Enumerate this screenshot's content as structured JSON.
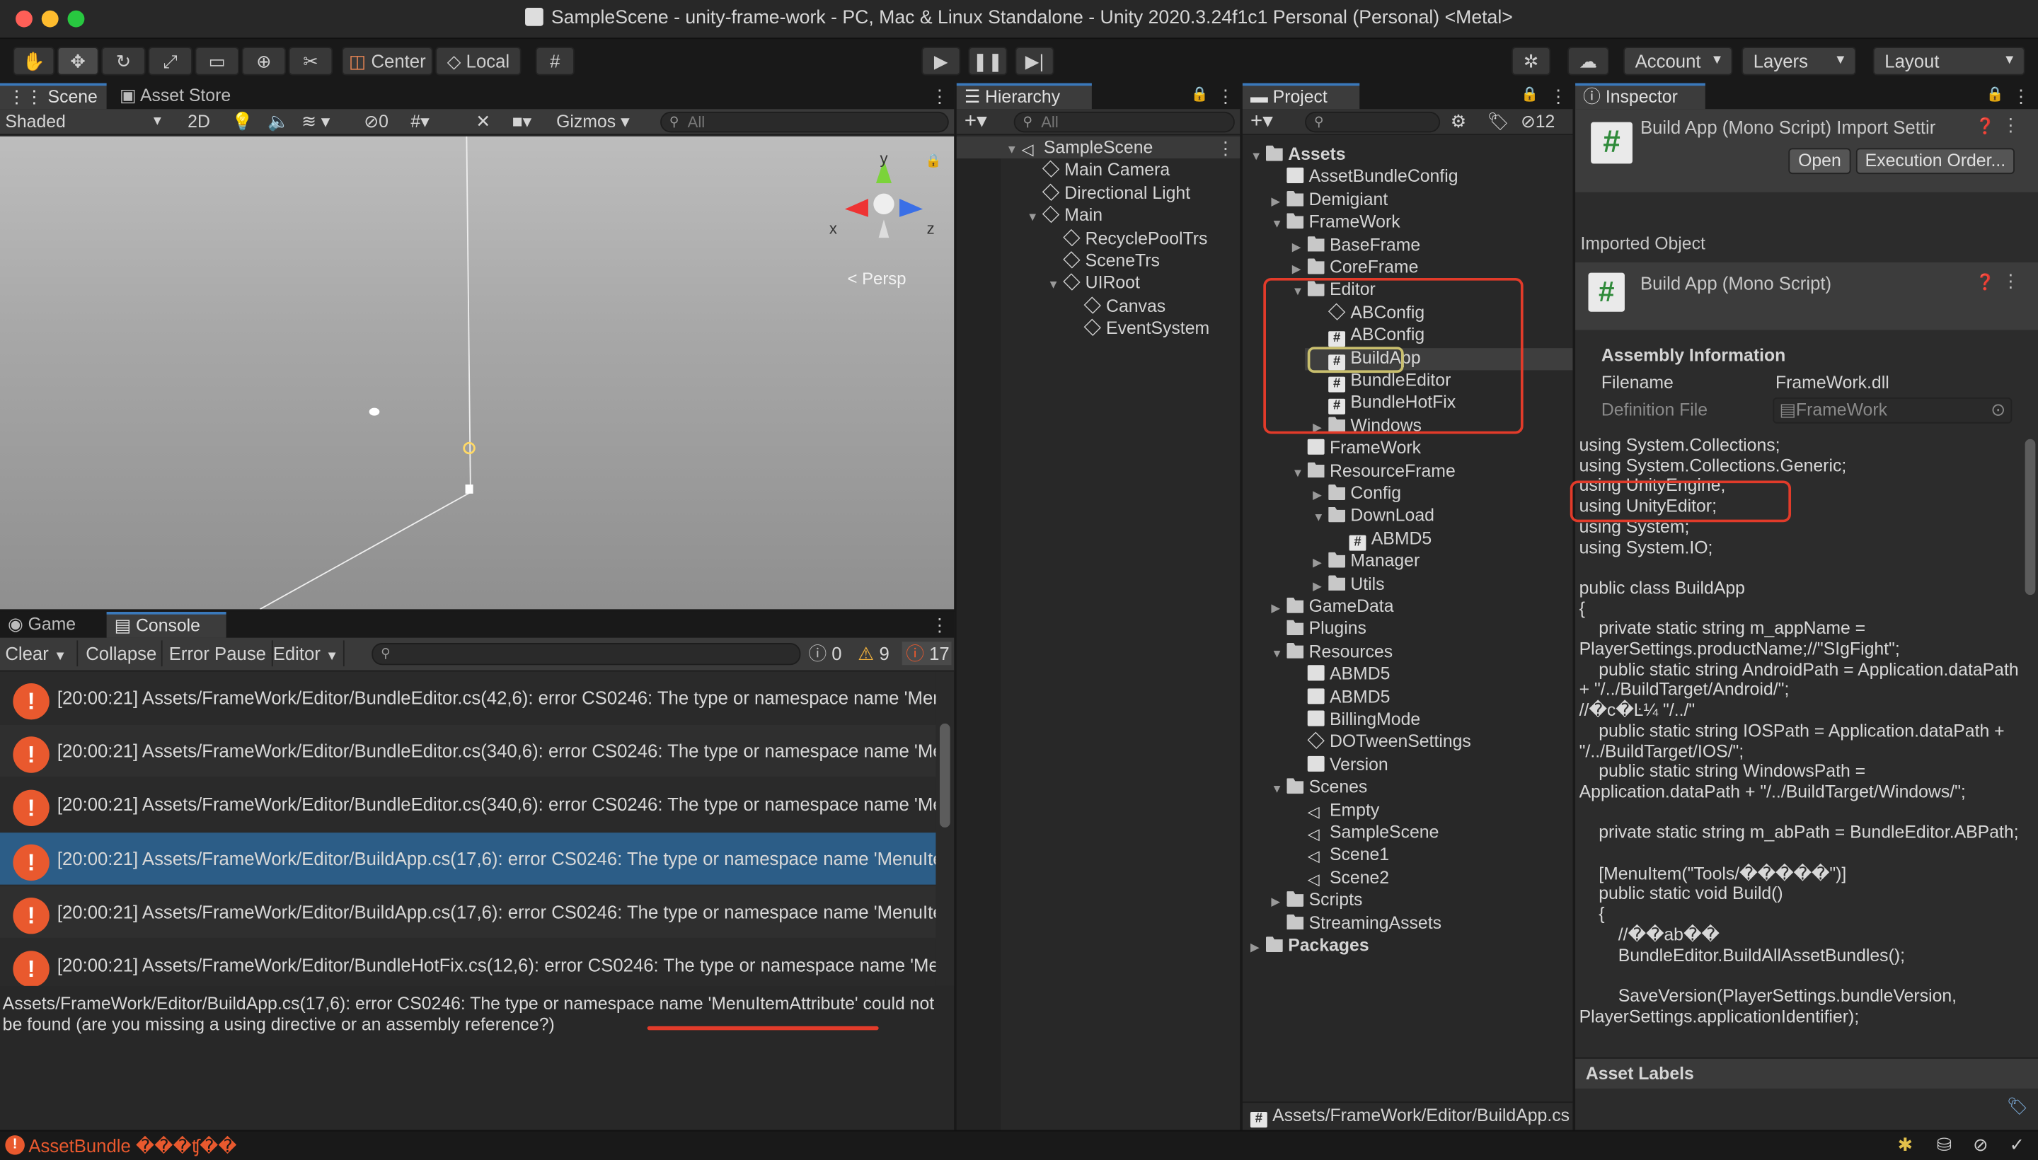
{
  "window": {
    "title": "SampleScene - unity-frame-work - PC, Mac & Linux Standalone - Unity 2020.3.24f1c1 Personal (Personal) <Metal>",
    "close_color": "#fe5f57",
    "min_color": "#febc2e",
    "max_color": "#28c840"
  },
  "toolbar": {
    "center": "Center",
    "local": "Local",
    "account": "Account",
    "layers": "Layers",
    "layout": "Layout"
  },
  "scene": {
    "tab_scene": "Scene",
    "tab_asset_store": "Asset Store",
    "shading": "Shaded",
    "mode2d": "2D",
    "hidden_count": "0",
    "gizmos": "Gizmos",
    "search_placeholder": "All",
    "persp": "< Persp",
    "axis_x": "x",
    "axis_y": "y",
    "axis_z": "z"
  },
  "hierarchy": {
    "tab": "Hierarchy",
    "search_placeholder": "All",
    "items": [
      {
        "label": "SampleScene",
        "depth": 0,
        "kind": "scene",
        "arrow": "open"
      },
      {
        "label": "Main Camera",
        "depth": 1,
        "kind": "go",
        "arrow": ""
      },
      {
        "label": "Directional Light",
        "depth": 1,
        "kind": "go",
        "arrow": ""
      },
      {
        "label": "Main",
        "depth": 1,
        "kind": "go",
        "arrow": "open"
      },
      {
        "label": "RecyclePoolTrs",
        "depth": 2,
        "kind": "go",
        "arrow": ""
      },
      {
        "label": "SceneTrs",
        "depth": 2,
        "kind": "go",
        "arrow": ""
      },
      {
        "label": "UIRoot",
        "depth": 2,
        "kind": "go",
        "arrow": "open"
      },
      {
        "label": "Canvas",
        "depth": 3,
        "kind": "go",
        "arrow": ""
      },
      {
        "label": "EventSystem",
        "depth": 3,
        "kind": "go",
        "arrow": ""
      }
    ]
  },
  "project": {
    "tab": "Project",
    "hidden_count": "12",
    "footer_path": "Assets/FrameWork/Editor/BuildApp.cs",
    "items": [
      {
        "label": "Assets",
        "depth": 0,
        "kind": "folder",
        "arrow": "open",
        "bold": true
      },
      {
        "label": "AssetBundleConfig",
        "depth": 1,
        "kind": "doc",
        "arrow": ""
      },
      {
        "label": "Demigiant",
        "depth": 1,
        "kind": "folder",
        "arrow": "closed"
      },
      {
        "label": "FrameWork",
        "depth": 1,
        "kind": "folder",
        "arrow": "open"
      },
      {
        "label": "BaseFrame",
        "depth": 2,
        "kind": "folder",
        "arrow": "closed"
      },
      {
        "label": "CoreFrame",
        "depth": 2,
        "kind": "folder",
        "arrow": "closed"
      },
      {
        "label": "Editor",
        "depth": 2,
        "kind": "folder",
        "arrow": "open"
      },
      {
        "label": "ABConfig",
        "depth": 3,
        "kind": "cube",
        "arrow": ""
      },
      {
        "label": "ABConfig",
        "depth": 3,
        "kind": "cs",
        "arrow": ""
      },
      {
        "label": "BuildApp",
        "depth": 3,
        "kind": "cs",
        "arrow": "",
        "selected": true
      },
      {
        "label": "BundleEditor",
        "depth": 3,
        "kind": "cs",
        "arrow": ""
      },
      {
        "label": "BundleHotFix",
        "depth": 3,
        "kind": "cs",
        "arrow": ""
      },
      {
        "label": "Windows",
        "depth": 3,
        "kind": "folder",
        "arrow": "closed"
      },
      {
        "label": "FrameWork",
        "depth": 2,
        "kind": "doc",
        "arrow": ""
      },
      {
        "label": "ResourceFrame",
        "depth": 2,
        "kind": "folder",
        "arrow": "open"
      },
      {
        "label": "Config",
        "depth": 3,
        "kind": "folder",
        "arrow": "closed"
      },
      {
        "label": "DownLoad",
        "depth": 3,
        "kind": "folder",
        "arrow": "open"
      },
      {
        "label": "ABMD5",
        "depth": 4,
        "kind": "cs",
        "arrow": ""
      },
      {
        "label": "Manager",
        "depth": 3,
        "kind": "folder",
        "arrow": "closed"
      },
      {
        "label": "Utils",
        "depth": 3,
        "kind": "folder",
        "arrow": "closed"
      },
      {
        "label": "GameData",
        "depth": 1,
        "kind": "folder",
        "arrow": "closed"
      },
      {
        "label": "Plugins",
        "depth": 1,
        "kind": "folder",
        "arrow": ""
      },
      {
        "label": "Resources",
        "depth": 1,
        "kind": "folder",
        "arrow": "open"
      },
      {
        "label": "ABMD5",
        "depth": 2,
        "kind": "doc",
        "arrow": ""
      },
      {
        "label": "ABMD5",
        "depth": 2,
        "kind": "doc",
        "arrow": ""
      },
      {
        "label": "BillingMode",
        "depth": 2,
        "kind": "doc",
        "arrow": ""
      },
      {
        "label": "DOTweenSettings",
        "depth": 2,
        "kind": "cube",
        "arrow": ""
      },
      {
        "label": "Version",
        "depth": 2,
        "kind": "doc",
        "arrow": ""
      },
      {
        "label": "Scenes",
        "depth": 1,
        "kind": "folder",
        "arrow": "open"
      },
      {
        "label": "Empty",
        "depth": 2,
        "kind": "scene",
        "arrow": ""
      },
      {
        "label": "SampleScene",
        "depth": 2,
        "kind": "scene",
        "arrow": ""
      },
      {
        "label": "Scene1",
        "depth": 2,
        "kind": "scene",
        "arrow": ""
      },
      {
        "label": "Scene2",
        "depth": 2,
        "kind": "scene",
        "arrow": ""
      },
      {
        "label": "Scripts",
        "depth": 1,
        "kind": "folder",
        "arrow": "closed"
      },
      {
        "label": "StreamingAssets",
        "depth": 1,
        "kind": "folder",
        "arrow": ""
      },
      {
        "label": "Packages",
        "depth": 0,
        "kind": "folder",
        "arrow": "closed",
        "bold": true
      }
    ]
  },
  "inspector": {
    "tab": "Inspector",
    "title": "Build App (Mono Script) Import Settir",
    "open_btn": "Open",
    "exec_order_btn": "Execution Order...",
    "imported_object": "Imported Object",
    "obj_title": "Build App (Mono Script)",
    "assembly_header": "Assembly Information",
    "filename_label": "Filename",
    "filename_value": "FrameWork.dll",
    "def_file_label": "Definition File",
    "def_file_value": "FrameWork",
    "asset_labels": "Asset Labels",
    "code": "using System.Collections;\nusing System.Collections.Generic;\nusing UnityEngine;\nusing UnityEditor;\nusing System;\nusing System.IO;\n\npublic class BuildApp\n{\n    private static string m_appName = PlayerSettings.productName;//\"SIgFight\";\n    public static string AndroidPath = Application.dataPath + \"/../BuildTarget/Android/\";\n//�c�Ŀ¼ \"/../\"\n    public static string IOSPath = Application.dataPath + \"/../BuildTarget/IOS/\";\n    public static string WindowsPath = Application.dataPath + \"/../BuildTarget/Windows/\";\n\n    private static string m_abPath = BundleEditor.ABPath;\n\n    [MenuItem(\"Tools/�����\")]\n    public static void Build()\n    {\n        //��ab��\n        BundleEditor.BuildAllAssetBundles();\n\n        SaveVersion(PlayerSettings.bundleVersion, PlayerSettings.applicationIdentifier);"
  },
  "console": {
    "tab_game": "Game",
    "tab_console": "Console",
    "clear": "Clear",
    "collapse": "Collapse",
    "error_pause": "Error Pause",
    "editor": "Editor",
    "count_info": "0",
    "count_warn": "9",
    "count_error": "17",
    "rows": [
      "[20:00:21] Assets/FrameWork/Editor/BundleEditor.cs(42,6): error CS0246: The type or namespace name 'MenuItem",
      "[20:00:21] Assets/FrameWork/Editor/BundleEditor.cs(340,6): error CS0246: The type or namespace name 'MenuItem",
      "[20:00:21] Assets/FrameWork/Editor/BundleEditor.cs(340,6): error CS0246: The type or namespace name 'MenuItem",
      "[20:00:21] Assets/FrameWork/Editor/BuildApp.cs(17,6): error CS0246: The type or namespace name 'MenuItemAttribute'",
      "[20:00:21] Assets/FrameWork/Editor/BuildApp.cs(17,6): error CS0246: The type or namespace name 'MenuItem",
      "[20:00:21] Assets/FrameWork/Editor/BundleHotFix.cs(12,6): error CS0246: The type or namespace name 'MenuItem"
    ],
    "detail": "Assets/FrameWork/Editor/BuildApp.cs(17,6): error CS0246: The type or namespace name 'MenuItemAttribute' could not be found (are you missing a using directive or an assembly reference?)"
  },
  "statusbar": {
    "message": "AssetBundle ���ʧ��"
  },
  "colors": {
    "accent": "#3a79bb",
    "error": "#e9592e",
    "highlight": "#e23b2a",
    "selection": "#2c5d87"
  }
}
